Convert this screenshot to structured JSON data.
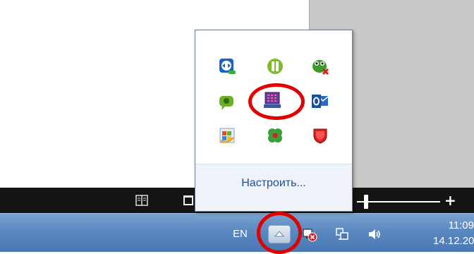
{
  "popup": {
    "icons": [
      {
        "name": "teamviewer-icon"
      },
      {
        "name": "info-green-icon"
      },
      {
        "name": "frog-icon"
      },
      {
        "name": "chat-green-icon"
      },
      {
        "name": "purple-keyboard-icon"
      },
      {
        "name": "outlook-icon"
      },
      {
        "name": "windows-update-icon"
      },
      {
        "name": "clover-icon"
      },
      {
        "name": "shield-red-icon"
      }
    ],
    "customize_label": "Настроить..."
  },
  "taskbar": {
    "language": "EN",
    "time": "11:09",
    "date": "14.12.20"
  },
  "colors": {
    "taskbar": "#5a88c0",
    "highlight_circle": "#e00000",
    "link": "#1f4fa0"
  }
}
